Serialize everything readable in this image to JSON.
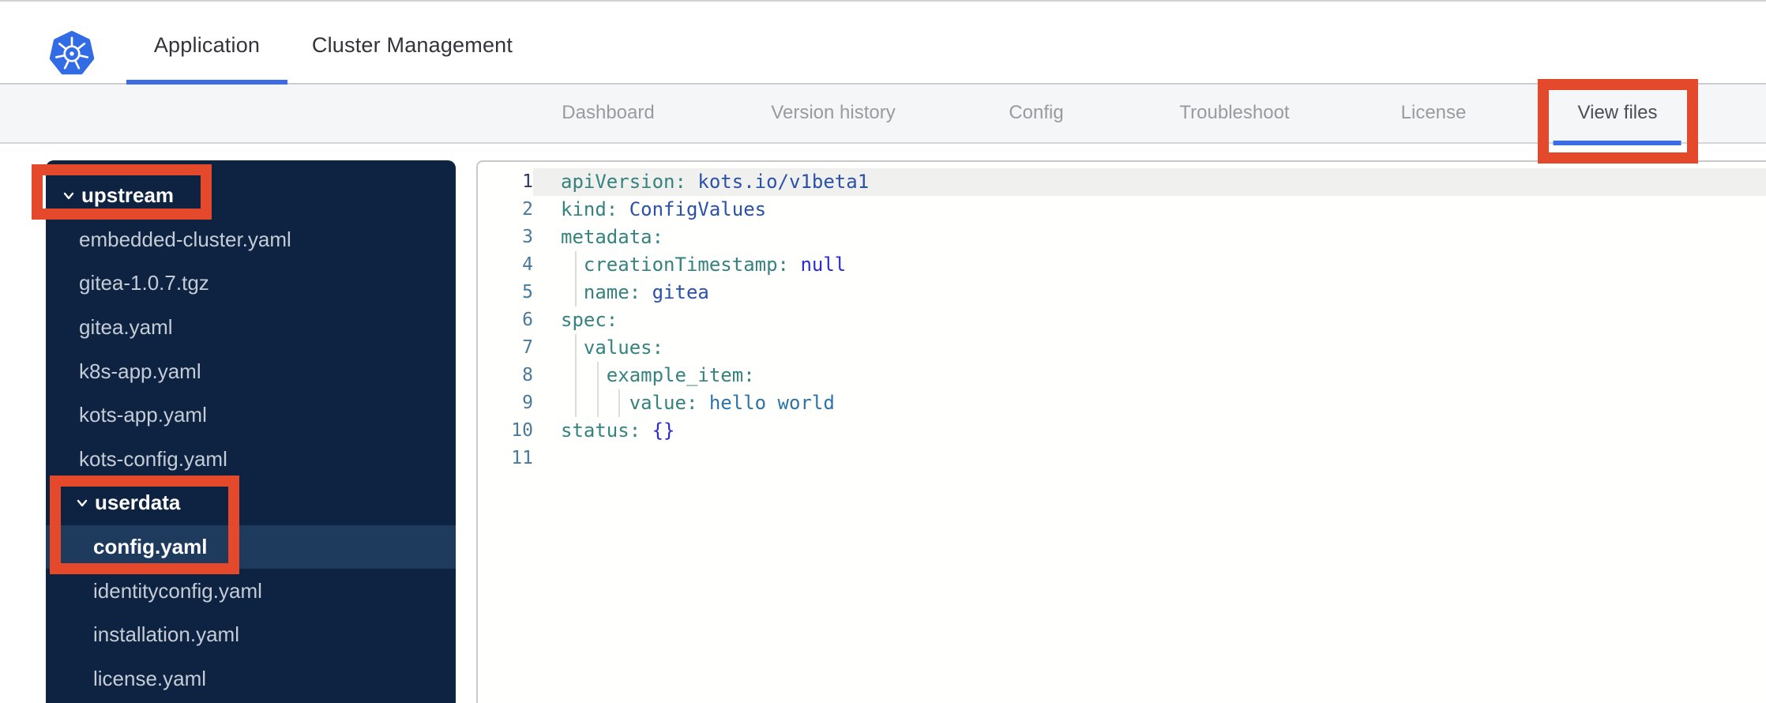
{
  "topnav": {
    "logo": "kubernetes-logo",
    "tabs": [
      {
        "label": "Application",
        "active": true
      },
      {
        "label": "Cluster Management",
        "active": false
      }
    ]
  },
  "subnav": {
    "tabs": [
      {
        "label": "Dashboard",
        "active": false
      },
      {
        "label": "Version history",
        "active": false
      },
      {
        "label": "Config",
        "active": false
      },
      {
        "label": "Troubleshoot",
        "active": false
      },
      {
        "label": "License",
        "active": false
      },
      {
        "label": "View files",
        "active": true,
        "annotated": true
      }
    ]
  },
  "file_tree": {
    "items": [
      {
        "label": "upstream",
        "type": "folder",
        "level": 0,
        "expanded": true,
        "annotated": true
      },
      {
        "label": "embedded-cluster.yaml",
        "type": "file",
        "level": 1
      },
      {
        "label": "gitea-1.0.7.tgz",
        "type": "file",
        "level": 1
      },
      {
        "label": "gitea.yaml",
        "type": "file",
        "level": 1
      },
      {
        "label": "k8s-app.yaml",
        "type": "file",
        "level": 1
      },
      {
        "label": "kots-app.yaml",
        "type": "file",
        "level": 1
      },
      {
        "label": "kots-config.yaml",
        "type": "file",
        "level": 1
      },
      {
        "label": "userdata",
        "type": "folder",
        "level": 1,
        "expanded": true,
        "annotated": true
      },
      {
        "label": "config.yaml",
        "type": "file",
        "level": 2,
        "selected": true,
        "annotated": true
      },
      {
        "label": "identityconfig.yaml",
        "type": "file",
        "level": 2
      },
      {
        "label": "installation.yaml",
        "type": "file",
        "level": 2
      },
      {
        "label": "license.yaml",
        "type": "file",
        "level": 2
      }
    ]
  },
  "editor": {
    "language": "yaml",
    "lines": [
      {
        "num": 1,
        "active": true,
        "guides": 0,
        "segments": [
          {
            "text": "apiVersion:",
            "color": "key"
          },
          {
            "text": " kots.io/v1beta1",
            "color": "val"
          }
        ]
      },
      {
        "num": 2,
        "guides": 0,
        "segments": [
          {
            "text": "kind:",
            "color": "key"
          },
          {
            "text": " ConfigValues",
            "color": "val"
          }
        ]
      },
      {
        "num": 3,
        "guides": 0,
        "segments": [
          {
            "text": "metadata:",
            "color": "key"
          }
        ]
      },
      {
        "num": 4,
        "guides": 1,
        "segments": [
          {
            "text": "  ",
            "color": "plain"
          },
          {
            "text": "creationTimestamp:",
            "color": "key"
          },
          {
            "text": " null",
            "color": "const"
          }
        ]
      },
      {
        "num": 5,
        "guides": 1,
        "segments": [
          {
            "text": "  ",
            "color": "plain"
          },
          {
            "text": "name:",
            "color": "key"
          },
          {
            "text": " gitea",
            "color": "val"
          }
        ]
      },
      {
        "num": 6,
        "guides": 0,
        "segments": [
          {
            "text": "spec:",
            "color": "key"
          }
        ]
      },
      {
        "num": 7,
        "guides": 1,
        "segments": [
          {
            "text": "  ",
            "color": "plain"
          },
          {
            "text": "values:",
            "color": "key"
          }
        ]
      },
      {
        "num": 8,
        "guides": 2,
        "segments": [
          {
            "text": "    ",
            "color": "plain"
          },
          {
            "text": "example_item:",
            "color": "key"
          }
        ]
      },
      {
        "num": 9,
        "guides": 3,
        "segments": [
          {
            "text": "      ",
            "color": "plain"
          },
          {
            "text": "value:",
            "color": "key"
          },
          {
            "text": " hello world",
            "color": "str"
          }
        ]
      },
      {
        "num": 10,
        "guides": 0,
        "segments": [
          {
            "text": "status:",
            "color": "key"
          },
          {
            "text": " {}",
            "color": "const"
          }
        ]
      },
      {
        "num": 11,
        "guides": 0,
        "segments": []
      }
    ]
  },
  "annotations": {
    "color": "#e4492c",
    "boxes": [
      "view-files-tab",
      "upstream-folder",
      "userdata-config-yaml"
    ]
  },
  "colors": {
    "brand_blue": "#3d6de4",
    "logo_blue": "#326ce5",
    "sidebar_bg": "#0e2342",
    "sidebar_selected": "#1e3a5c",
    "annotation_red": "#e4492c",
    "token_key": "#35827f",
    "token_value": "#2b50aa",
    "token_string": "#2e73a8",
    "token_constant": "#2a2ad4"
  }
}
